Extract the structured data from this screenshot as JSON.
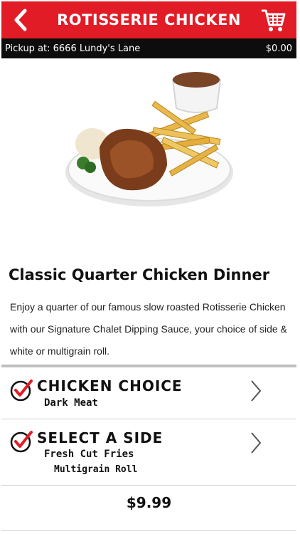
{
  "header": {
    "title": "ROTISSERIE CHICKEN",
    "back_icon": "chevron-left-icon",
    "cart_icon": "shopping-cart-icon",
    "color": "#e11c26"
  },
  "pickup": {
    "location": "Pickup at: 6666 Lundy's Lane",
    "total": "$0.00"
  },
  "product": {
    "image": "quarter-chicken-dinner-photo",
    "title": "Classic Quarter Chicken Dinner",
    "description": "Enjoy a quarter of our famous slow roasted Rotisserie Chicken with our Signature Chalet Dipping Sauce, your choice of side & white or multigrain roll."
  },
  "options": [
    {
      "title": "CHICKEN CHOICE",
      "values": [
        "Dark Meat"
      ],
      "icon": "checkmark-circle-icon"
    },
    {
      "title": "SELECT A SIDE",
      "values": [
        "Fresh Cut Fries",
        "Multigrain Roll"
      ],
      "icon": "checkmark-circle-icon"
    }
  ],
  "price": "$9.99"
}
